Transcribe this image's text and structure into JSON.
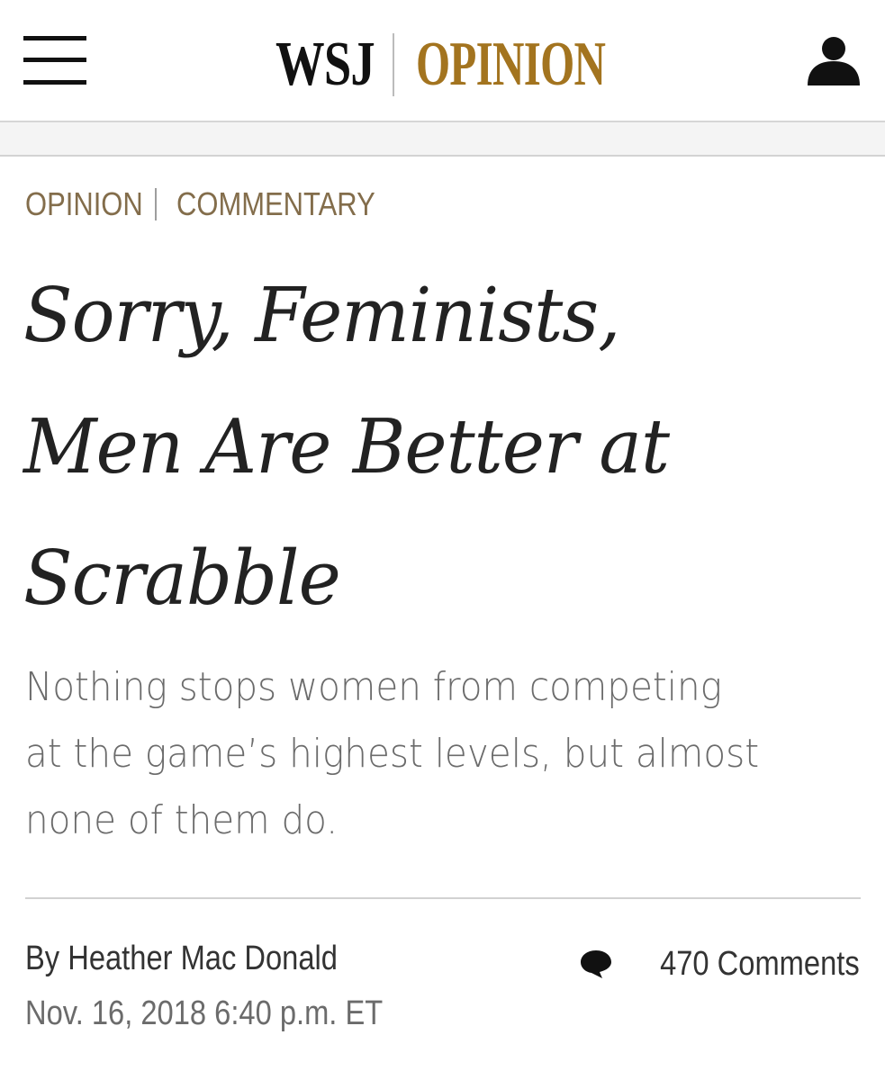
{
  "header": {
    "menu_icon": "hamburger-menu-icon",
    "logo_wsj": "WSJ",
    "logo_section": "OPINION",
    "user_icon": "user-account-icon",
    "brand_color": "#a3741f"
  },
  "breadcrumb": {
    "section": "OPINION",
    "subsection": "COMMENTARY",
    "color": "#836d4b"
  },
  "article": {
    "headline_lines": [
      "Sorry, Feminists,",
      "Men Are Better at",
      "Scrabble"
    ],
    "dek_lines": [
      "Nothing stops women from competing",
      "at the game’s highest levels, but almost",
      "none of them do."
    ],
    "byline_prefix": "By",
    "author": "Heather Mac Donald",
    "timestamp": "Nov. 16, 2018 6:40 p.m. ET",
    "comments_icon": "speech-bubble-icon",
    "comments_label": "470 Comments"
  }
}
